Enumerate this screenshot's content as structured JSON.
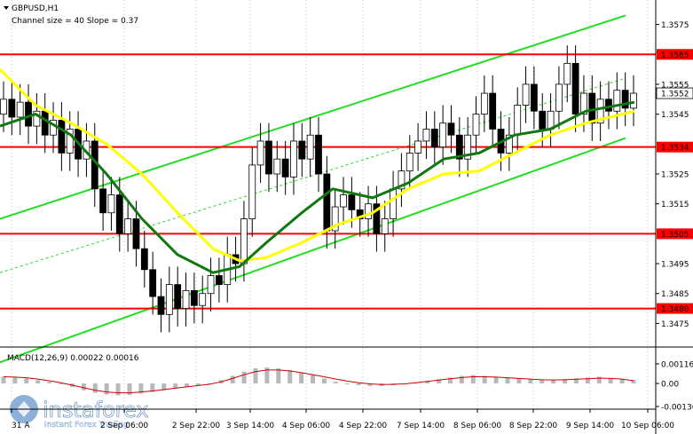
{
  "header": {
    "symbol": "GBPUSD,H1",
    "channel": "Channel size = 40 Slope = 0.37"
  },
  "macd": {
    "label": "MACD(12,26,9) 0.00022 0.00016",
    "ticks": [
      "0.00116",
      "0.00",
      "-0.00136"
    ]
  },
  "watermark": {
    "brand": "instaforex",
    "tagline": "Instant Forex Trading"
  },
  "chart_data": {
    "type": "candlestick",
    "symbol": "GBPUSD",
    "timeframe": "H1",
    "ylim": [
      1.3468,
      1.3582
    ],
    "y_ticks": [
      "1.3575",
      "1.3565",
      "1.3555",
      "1.3552",
      "1.3545",
      "1.3534",
      "1.3525",
      "1.3515",
      "1.3505",
      "1.3495",
      "1.3485",
      "1.3480",
      "1.3475"
    ],
    "x_ticks": [
      "31 A",
      "2 Sep 06:00",
      "2 Sep 22:00",
      "3 Sep 14:00",
      "4 Sep 06:00",
      "4 Sep 22:00",
      "7 Sep 14:00",
      "8 Sep 06:00",
      "8 Sep 22:00",
      "9 Sep 14:00",
      "10 Sep 06:00"
    ],
    "current_price": 1.3552,
    "levels": [
      {
        "value": 1.3565,
        "label": "1.3565",
        "color": "#ff0000"
      },
      {
        "value": 1.3534,
        "label": "1.3534",
        "color": "#ff0000"
      },
      {
        "value": 1.3505,
        "label": "1.3505",
        "color": "#ff0000"
      },
      {
        "value": 1.348,
        "label": "1.3480",
        "color": "#ff0000"
      }
    ],
    "channel": {
      "color": "#22dd22",
      "upper": [
        [
          0,
          1.351
        ],
        [
          705,
          1.3578
        ]
      ],
      "lower": [
        [
          0,
          1.3462
        ],
        [
          705,
          1.3537
        ]
      ],
      "mid": [
        [
          0,
          1.3492
        ],
        [
          705,
          1.3557
        ]
      ]
    },
    "moving_averages": [
      {
        "color": "#ffff00",
        "points": [
          [
            0,
            1.356
          ],
          [
            40,
            1.3548
          ],
          [
            80,
            1.3542
          ],
          [
            120,
            1.3535
          ],
          [
            160,
            1.3525
          ],
          [
            200,
            1.3512
          ],
          [
            240,
            1.35
          ],
          [
            270,
            1.3496
          ],
          [
            300,
            1.3497
          ],
          [
            340,
            1.3502
          ],
          [
            380,
            1.3508
          ],
          [
            420,
            1.3512
          ],
          [
            460,
            1.352
          ],
          [
            500,
            1.3525
          ],
          [
            540,
            1.3526
          ],
          [
            580,
            1.3532
          ],
          [
            620,
            1.3538
          ],
          [
            660,
            1.3542
          ],
          [
            715,
            1.3546
          ]
        ]
      },
      {
        "color": "#117711",
        "points": [
          [
            0,
            1.3541
          ],
          [
            40,
            1.3545
          ],
          [
            80,
            1.3538
          ],
          [
            120,
            1.3525
          ],
          [
            160,
            1.351
          ],
          [
            200,
            1.3498
          ],
          [
            240,
            1.3492
          ],
          [
            270,
            1.3494
          ],
          [
            300,
            1.3502
          ],
          [
            340,
            1.3512
          ],
          [
            375,
            1.352
          ],
          [
            420,
            1.3517
          ],
          [
            460,
            1.3522
          ],
          [
            500,
            1.353
          ],
          [
            540,
            1.3532
          ],
          [
            580,
            1.3538
          ],
          [
            620,
            1.354
          ],
          [
            660,
            1.3546
          ],
          [
            715,
            1.3549
          ]
        ]
      }
    ],
    "candles": [
      [
        1.3545,
        1.355
      ],
      [
        1.355,
        1.3544
      ],
      [
        1.3544,
        1.3549
      ],
      [
        1.3549,
        1.3541
      ],
      [
        1.3541,
        1.3546
      ],
      [
        1.3546,
        1.3538
      ],
      [
        1.3538,
        1.3543
      ],
      [
        1.3543,
        1.3532
      ],
      [
        1.3532,
        1.354
      ],
      [
        1.354,
        1.353
      ],
      [
        1.353,
        1.3536
      ],
      [
        1.3536,
        1.352
      ],
      [
        1.352,
        1.3512
      ],
      [
        1.3512,
        1.3518
      ],
      [
        1.3518,
        1.3505
      ],
      [
        1.3505,
        1.351
      ],
      [
        1.351,
        1.35
      ],
      [
        1.35,
        1.3493
      ],
      [
        1.3493,
        1.3484
      ],
      [
        1.3484,
        1.3478
      ],
      [
        1.3478,
        1.3488
      ],
      [
        1.3488,
        1.348
      ],
      [
        1.348,
        1.3486
      ],
      [
        1.3486,
        1.3481
      ],
      [
        1.3481,
        1.3485
      ],
      [
        1.3485,
        1.3491
      ],
      [
        1.3491,
        1.3488
      ],
      [
        1.3488,
        1.3498
      ],
      [
        1.3498,
        1.3495
      ],
      [
        1.3495,
        1.351
      ],
      [
        1.351,
        1.3528
      ],
      [
        1.3528,
        1.3536
      ],
      [
        1.3536,
        1.3525
      ],
      [
        1.3525,
        1.353
      ],
      [
        1.353,
        1.3524
      ],
      [
        1.3524,
        1.3536
      ],
      [
        1.3536,
        1.353
      ],
      [
        1.353,
        1.3538
      ],
      [
        1.3538,
        1.3525
      ],
      [
        1.3525,
        1.3506
      ],
      [
        1.3506,
        1.3514
      ],
      [
        1.3514,
        1.3518
      ],
      [
        1.3518,
        1.3513
      ],
      [
        1.3513,
        1.351
      ],
      [
        1.351,
        1.3515
      ],
      [
        1.3515,
        1.3505
      ],
      [
        1.3505,
        1.351
      ],
      [
        1.351,
        1.352
      ],
      [
        1.352,
        1.3526
      ],
      [
        1.3526,
        1.3532
      ],
      [
        1.3532,
        1.3536
      ],
      [
        1.3536,
        1.354
      ],
      [
        1.354,
        1.3534
      ],
      [
        1.3534,
        1.3542
      ],
      [
        1.3542,
        1.3538
      ],
      [
        1.3538,
        1.353
      ],
      [
        1.353,
        1.3538
      ],
      [
        1.3538,
        1.3545
      ],
      [
        1.3545,
        1.3552
      ],
      [
        1.3552,
        1.354
      ],
      [
        1.354,
        1.3532
      ],
      [
        1.3532,
        1.3538
      ],
      [
        1.3538,
        1.3548
      ],
      [
        1.3548,
        1.3555
      ],
      [
        1.3555,
        1.3546
      ],
      [
        1.3546,
        1.354
      ],
      [
        1.354,
        1.3546
      ],
      [
        1.3546,
        1.3555
      ],
      [
        1.3555,
        1.3562
      ],
      [
        1.3562,
        1.3545
      ],
      [
        1.3545,
        1.3552
      ],
      [
        1.3552,
        1.3542
      ],
      [
        1.3542,
        1.355
      ],
      [
        1.355,
        1.3546
      ],
      [
        1.3546,
        1.3553
      ],
      [
        1.3553,
        1.3547
      ],
      [
        1.3547,
        1.3552
      ]
    ],
    "macd_hist": [
      0.0004,
      0.00035,
      0.0003,
      0.0002,
      0.0001,
      0.0,
      -0.0002,
      -0.0004,
      -0.00055,
      -0.00065,
      -0.0007,
      -0.00068,
      -0.0006,
      -0.0005,
      -0.0004,
      -0.0003,
      -0.0002,
      -0.0001,
      0.0,
      0.0002,
      0.00045,
      0.0007,
      0.0009,
      0.00095,
      0.0009,
      0.0008,
      0.00065,
      0.0005,
      0.0003,
      0.0001,
      0.0,
      -0.0001,
      -0.00015,
      -0.00015,
      -0.0001,
      -5e-05,
      5e-05,
      0.00015,
      0.00025,
      0.00035,
      0.00045,
      0.0005,
      0.00045,
      0.0004,
      0.00035,
      0.0003,
      0.00025,
      0.0002,
      0.0002,
      0.00025,
      0.0003,
      0.00035,
      0.0004,
      0.0003,
      0.00025,
      0.00022
    ],
    "macd_signal": [
      0.0004,
      0.00038,
      0.00034,
      0.00026,
      0.00016,
      4e-05,
      -0.0001,
      -0.00025,
      -0.0004,
      -0.0005,
      -0.00055,
      -0.00055,
      -0.0005,
      -0.00044,
      -0.00036,
      -0.00028,
      -0.0002,
      -0.00012,
      -4e-05,
      0.0001,
      0.0003,
      0.00052,
      0.0007,
      0.0008,
      0.0008,
      0.00074,
      0.00064,
      0.00052,
      0.0004,
      0.00026,
      0.00014,
      4e-05,
      -2e-05,
      -6e-05,
      -5e-05,
      -2e-05,
      4e-05,
      0.00012,
      0.0002,
      0.00028,
      0.00035,
      0.0004,
      0.0004,
      0.00038,
      0.00034,
      0.0003,
      0.00026,
      0.00022,
      0.00021,
      0.00022,
      0.00025,
      0.00028,
      0.00032,
      0.0003,
      0.00026,
      0.00016
    ],
    "macd_range": [
      -0.00136,
      0.00116
    ]
  }
}
